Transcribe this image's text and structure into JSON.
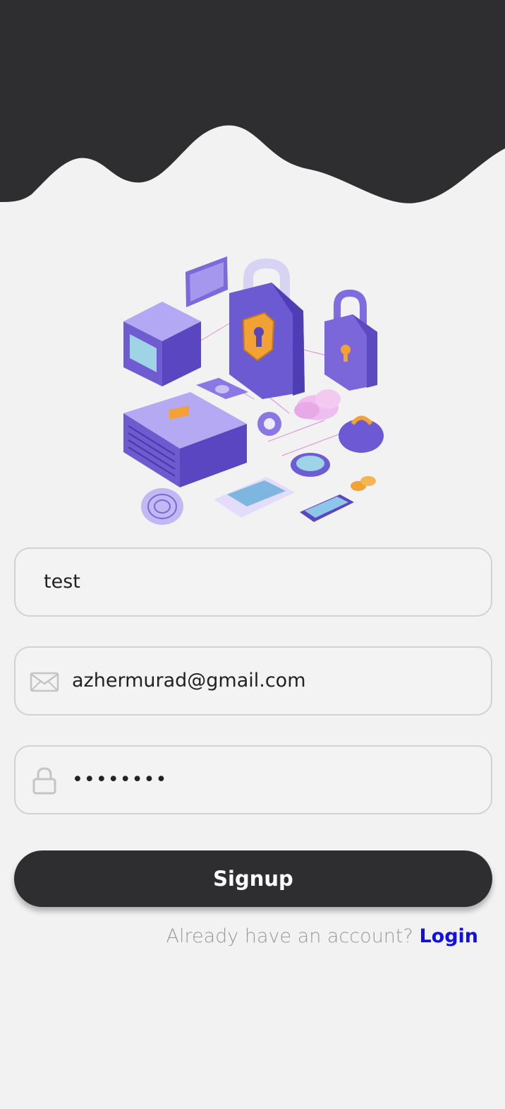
{
  "header": {
    "wave_color": "#2e2e30"
  },
  "illustration": {
    "description_icon": "cyber-security-isometric-illustration"
  },
  "form": {
    "name": {
      "value": "test"
    },
    "email": {
      "icon": "mail-icon",
      "value": "azhermurad@gmail.com"
    },
    "password": {
      "icon": "lock-icon",
      "value": "••••••••"
    },
    "signup_label": "Signup"
  },
  "footer": {
    "prompt": "Already have an account?",
    "login_label": "Login"
  },
  "colors": {
    "background": "#f2f2f2",
    "button": "#2e2e30",
    "link": "#1010e0",
    "field_border": "#d2d2d2"
  }
}
